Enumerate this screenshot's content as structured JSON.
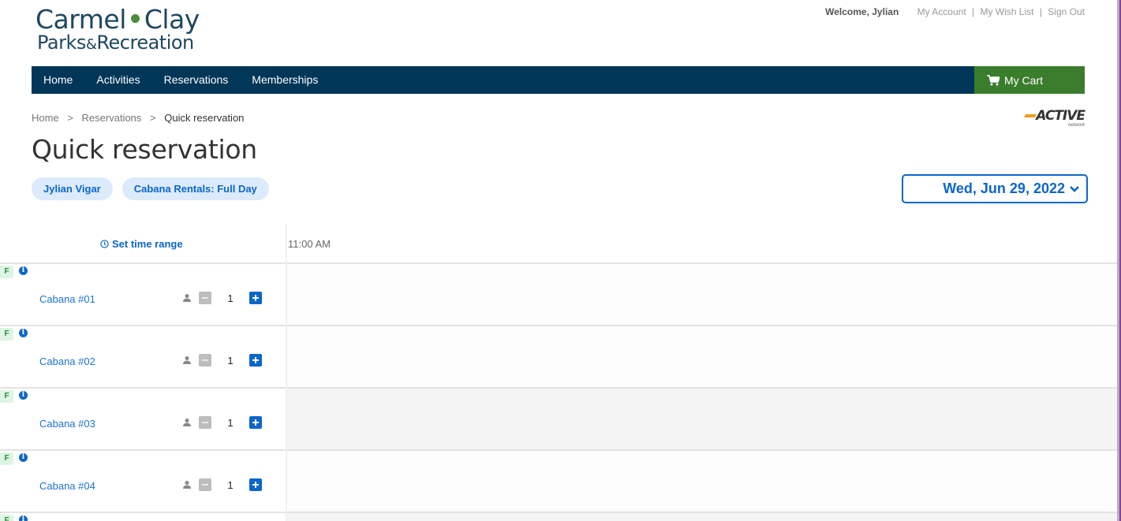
{
  "header": {
    "logo": {
      "line1_left": "Carmel",
      "line1_right": "Clay",
      "line2_left": "Parks",
      "line2_amp": "&",
      "line2_right": "Recreation"
    },
    "welcome": "Welcome, Jylian",
    "links": [
      {
        "label": "My Account"
      },
      {
        "label": "My Wish List"
      },
      {
        "label": "Sign Out"
      }
    ],
    "separator": "|"
  },
  "nav": {
    "items": [
      {
        "label": "Home"
      },
      {
        "label": "Activities"
      },
      {
        "label": "Reservations"
      },
      {
        "label": "Memberships"
      }
    ],
    "cart_label": "My Cart"
  },
  "breadcrumb": {
    "items": [
      {
        "label": "Home"
      },
      {
        "label": "Reservations"
      }
    ],
    "current": "Quick reservation",
    "separator": ">"
  },
  "active_logo": {
    "word": "ACTIVE",
    "sub": "network"
  },
  "page": {
    "title": "Quick reservation",
    "chips": [
      {
        "label": "Jylian Vigar"
      },
      {
        "label": "Cabana Rentals: Full Day"
      }
    ],
    "date": "Wed, Jun 29, 2022"
  },
  "grid": {
    "set_time_range": "Set time range",
    "time_columns": [
      "11:00 AM"
    ],
    "rows": [
      {
        "badge": "F",
        "name": "Cabana #01",
        "quantity": "1",
        "available": true
      },
      {
        "badge": "F",
        "name": "Cabana #02",
        "quantity": "1",
        "available": true
      },
      {
        "badge": "F",
        "name": "Cabana #03",
        "quantity": "1",
        "available": false
      },
      {
        "badge": "F",
        "name": "Cabana #04",
        "quantity": "1",
        "available": true
      },
      {
        "badge": "F",
        "name": "",
        "quantity": "",
        "available": false
      }
    ]
  },
  "colors": {
    "nav_bg": "#003658",
    "cart_bg": "#3a7d2c",
    "accent_blue": "#0c66c9",
    "chip_bg": "#dcebfb",
    "badge_bg": "#ddf5e2",
    "badge_text": "#2c8a3e"
  }
}
